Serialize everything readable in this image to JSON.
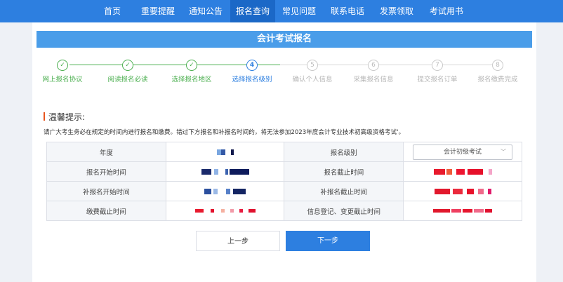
{
  "nav": {
    "items": [
      "首页",
      "重要提醒",
      "通知公告",
      "报名查询",
      "常见问题",
      "联系电话",
      "发票领取",
      "考试用书"
    ],
    "active_index": 3
  },
  "banner": {
    "title": "会计考试报名"
  },
  "steps": [
    {
      "num": "✓",
      "label": "网上报名协议",
      "state": "done"
    },
    {
      "num": "✓",
      "label": "阅读报名必读",
      "state": "done"
    },
    {
      "num": "✓",
      "label": "选择报名地区",
      "state": "done"
    },
    {
      "num": "4",
      "label": "选择报名级别",
      "state": "current"
    },
    {
      "num": "5",
      "label": "确认个人信息",
      "state": "todo"
    },
    {
      "num": "6",
      "label": "采集报名信息",
      "state": "todo"
    },
    {
      "num": "7",
      "label": "提交报名订单",
      "state": "todo"
    },
    {
      "num": "8",
      "label": "报名缴费完成",
      "state": "todo"
    }
  ],
  "tip": {
    "title": "温馨提示:",
    "text": "请广大考生务必在规定的时间内进行报名和缴费。错过下方报名和补报名时间的，将无法参加2023年度会计专业技术初高级资格考试'。"
  },
  "table": {
    "rows": [
      {
        "left_label": "年度",
        "right_label": "报名级别"
      },
      {
        "left_label": "报名开始时间",
        "right_label": "报名截止时间"
      },
      {
        "left_label": "补报名开始时间",
        "right_label": "补报名截止时间"
      },
      {
        "left_label": "缴费截止时间",
        "right_label": "信息登记、变更截止时间"
      }
    ],
    "level_select": {
      "value": "会计初级考试"
    }
  },
  "buttons": {
    "prev": "上一步",
    "next": "下一步"
  },
  "colors": {
    "primary": "#2d7fe0",
    "banner": "#4a9de9",
    "done": "#4caf50",
    "todo": "#c9c9c9",
    "accent": "#e8541e"
  }
}
